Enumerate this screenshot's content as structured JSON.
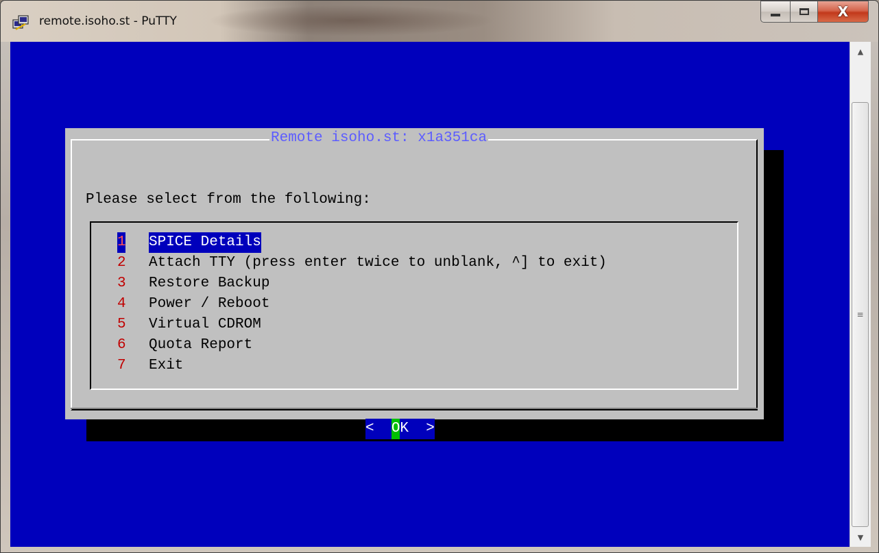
{
  "window": {
    "title": "remote.isoho.st - PuTTY",
    "close_glyph": "X"
  },
  "dialog": {
    "title": "Remote isoho.st: x1a351ca",
    "prompt": "Please select from the following:",
    "items": [
      {
        "key": "1",
        "label": "SPICE Details",
        "selected": true
      },
      {
        "key": "2",
        "label": "Attach TTY (press enter twice to unblank, ^] to exit)",
        "selected": false
      },
      {
        "key": "3",
        "label": "Restore Backup",
        "selected": false
      },
      {
        "key": "4",
        "label": "Power / Reboot",
        "selected": false
      },
      {
        "key": "5",
        "label": "Virtual CDROM",
        "selected": false
      },
      {
        "key": "6",
        "label": "Quota Report",
        "selected": false
      },
      {
        "key": "7",
        "label": "Exit",
        "selected": false
      }
    ],
    "button": {
      "left": "<  ",
      "hot": "O",
      "rest": "K  >"
    }
  },
  "colors": {
    "terminal_bg": "#0000bc",
    "dialog_bg": "#c0c0c0",
    "title_fg": "#5c5cff",
    "hotkey_fg": "#c00000",
    "selection_bg": "#0000bc",
    "button_hot_bg": "#00c000"
  },
  "icons": {
    "app": "putty-icon",
    "minimize": "minimize-icon",
    "maximize": "maximize-icon",
    "close": "close-icon",
    "scroll_up": "scroll-up-arrow-icon",
    "scroll_down": "scroll-down-arrow-icon",
    "scroll_grip": "scroll-grip-icon"
  }
}
